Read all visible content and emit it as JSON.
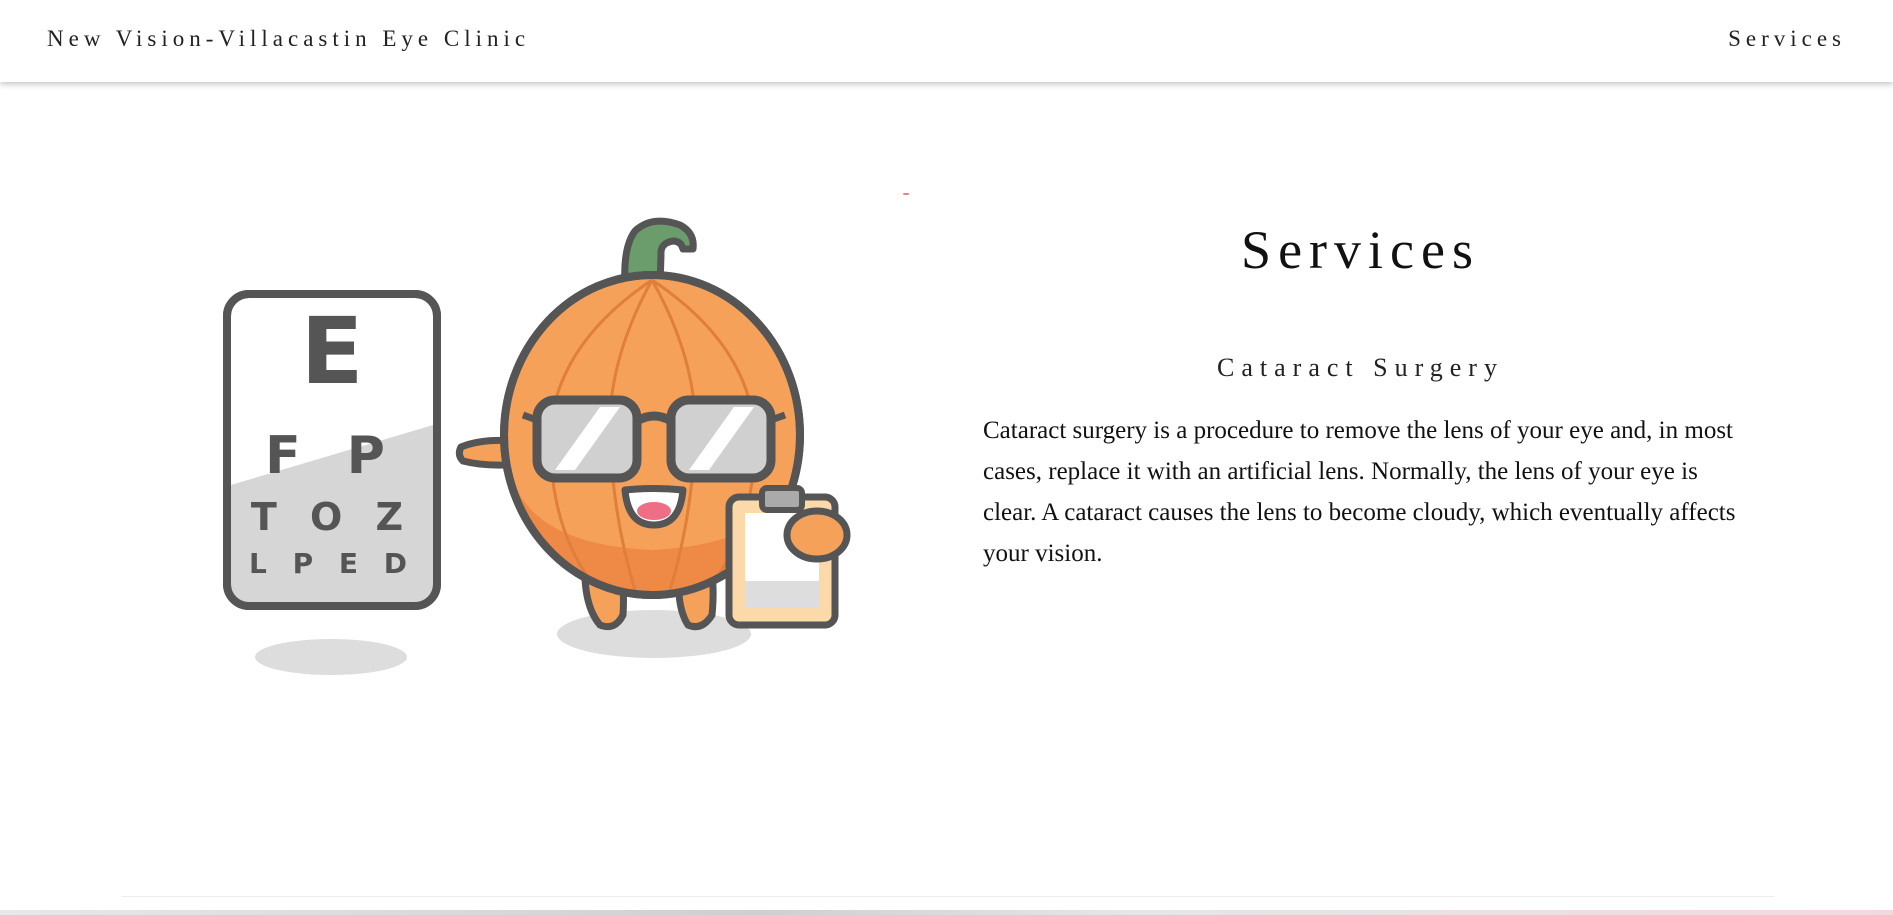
{
  "header": {
    "brand": "New Vision-Villacastin Eye Clinic",
    "nav": [
      {
        "label": "Services"
      }
    ]
  },
  "main": {
    "title": "Services",
    "illustration": {
      "icon": "pumpkin-eye-doctor-illustration",
      "chart_rows": [
        "E",
        "F P",
        "T O Z",
        "L P E D"
      ]
    },
    "service": {
      "name": "Cataract Surgery",
      "description": "Cataract surgery is a procedure to remove the lens of your eye and, in most cases, replace it with an artificial lens. Normally, the lens of your eye is clear. A cataract causes the lens to become cloudy, which eventually affects your vision."
    }
  },
  "colors": {
    "pumpkin": "#f5a15a",
    "pumpkin_dark": "#ee8a45",
    "outline": "#555555",
    "stem": "#6b9c6b",
    "clipboard": "#fbd9a8",
    "shadow": "#dddddd"
  }
}
